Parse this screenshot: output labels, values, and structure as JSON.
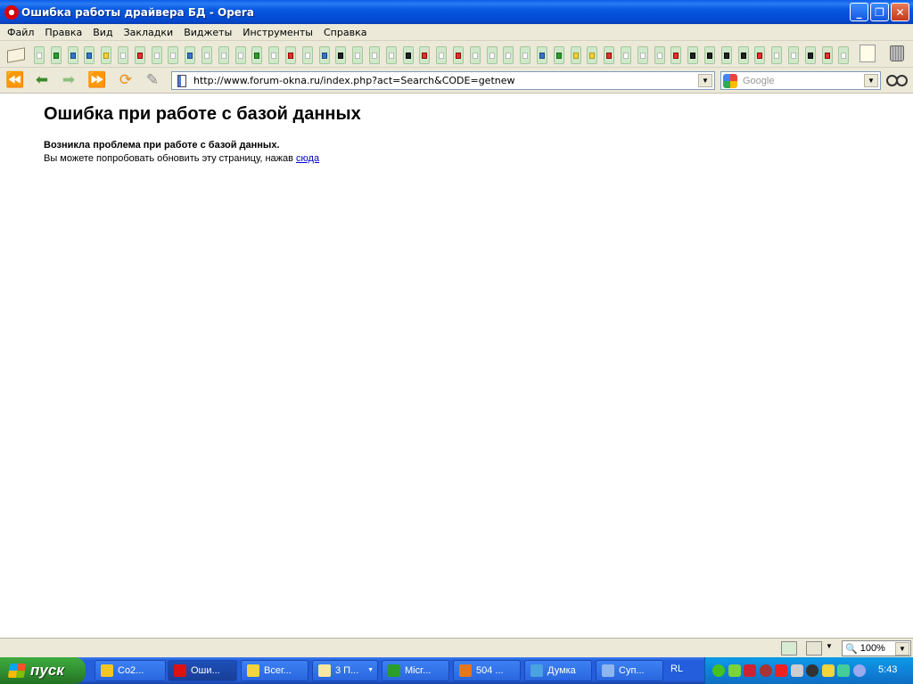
{
  "window": {
    "title": "Ошибка работы драйвера БД - Opera",
    "minimize": "_",
    "maximize": "❐",
    "close": "✕"
  },
  "menu": [
    "Файл",
    "Правка",
    "Вид",
    "Закладки",
    "Виджеты",
    "Инструменты",
    "Справка"
  ],
  "bookmarks": {
    "icons": [
      "blank",
      "excel",
      "down-arrow",
      "down-arrow",
      "folder",
      "bookmark",
      "gmail",
      "blank",
      "blank",
      "word",
      "blank",
      "blank",
      "blank",
      "chart",
      "blank",
      "stop",
      "refresh",
      "down-arrow",
      "b",
      "check",
      "blank",
      "blank",
      "m",
      "yandex",
      "blank",
      "circle",
      "blank",
      "blank",
      "blank",
      "blank",
      "screen",
      "flag",
      "key",
      "star",
      "film",
      "search",
      "blank",
      "pencil",
      "play",
      "dark",
      "dark",
      "dark",
      "p",
      "yandex",
      "blank",
      "blank",
      "dark",
      "yandex",
      "blank"
    ]
  },
  "nav": {
    "url": "http://www.forum-okna.ru/index.php?act=Search&CODE=getnew",
    "search_placeholder": "Google"
  },
  "page": {
    "heading": "Ошибка при работе с базой данных",
    "message_bold": "Возникла проблема при работе с базой данных.",
    "message_text": "Вы можете попробовать обновить эту страницу, нажав ",
    "link_text": "сюда"
  },
  "status": {
    "zoom": "100%"
  },
  "taskbar": {
    "start_label": "пуск",
    "tasks": [
      {
        "label": "Co2...",
        "color": "#f3c623"
      },
      {
        "label": "Оши...",
        "color": "#d11"
      },
      {
        "label": "Всег...",
        "color": "#f3d33e"
      },
      {
        "label": "3 П...",
        "color": "#f7e7a0"
      },
      {
        "label": "Micr...",
        "color": "#2b9d2b"
      },
      {
        "label": "504 ...",
        "color": "#e8761b"
      },
      {
        "label": "Думка",
        "color": "#4aa3e0"
      },
      {
        "label": "Суп...",
        "color": "#8fb6ee"
      }
    ],
    "language": "RL",
    "clock": "5:43",
    "tray_colors": [
      "#46c21f",
      "#7bd23b",
      "#c23",
      "#a33",
      "#e22",
      "#ccc",
      "#333",
      "#f3d33e",
      "#4c9",
      "#9ae"
    ]
  }
}
